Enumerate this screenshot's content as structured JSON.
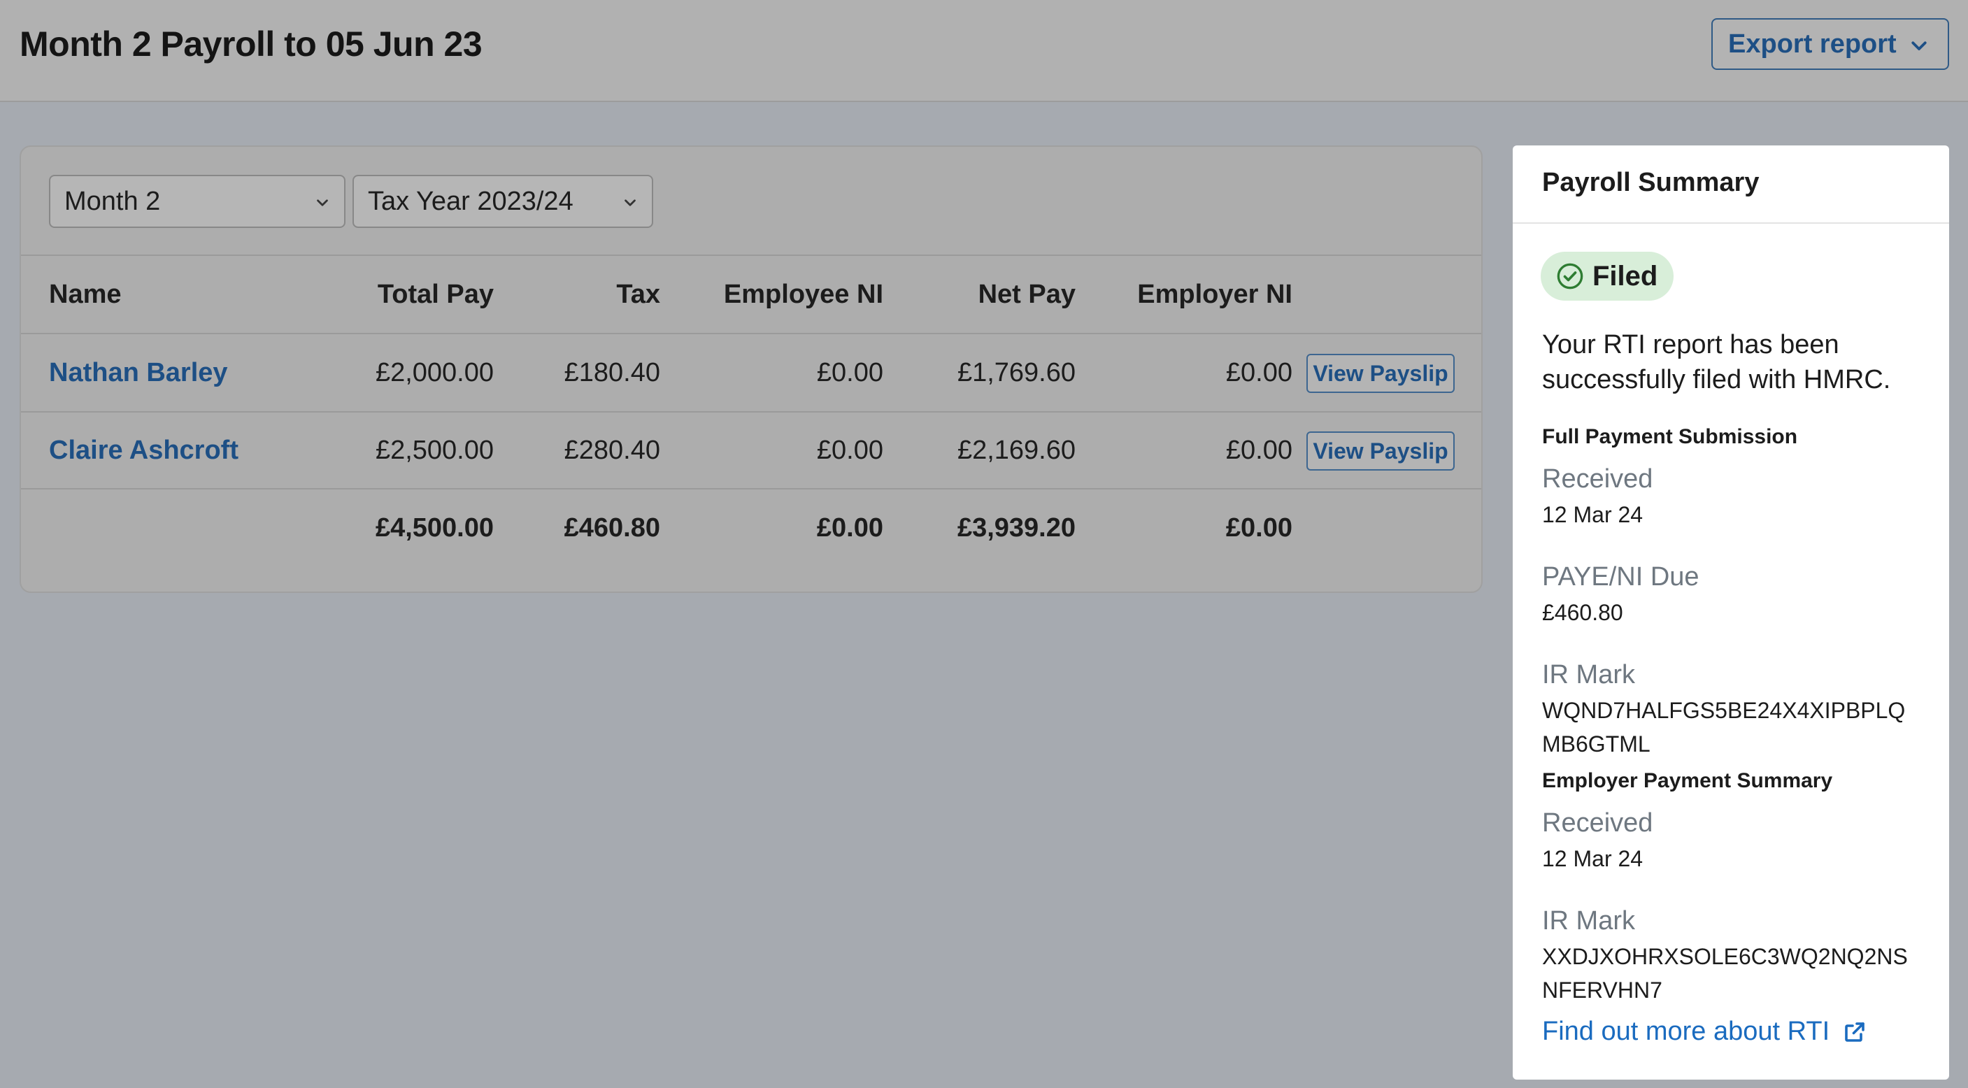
{
  "header": {
    "title": "Month 2 Payroll to 05 Jun 23",
    "export_label": "Export report"
  },
  "filters": {
    "month": "Month 2",
    "tax_year": "Tax Year 2023/24"
  },
  "table": {
    "columns": [
      "Name",
      "Total Pay",
      "Tax",
      "Employee NI",
      "Net Pay",
      "Employer NI"
    ],
    "rows": [
      {
        "name": "Nathan Barley",
        "total_pay": "£2,000.00",
        "tax": "£180.40",
        "employee_ni": "£0.00",
        "net_pay": "£1,769.60",
        "employer_ni": "£0.00",
        "action": "View Payslip"
      },
      {
        "name": "Claire Ashcroft",
        "total_pay": "£2,500.00",
        "tax": "£280.40",
        "employee_ni": "£0.00",
        "net_pay": "£2,169.60",
        "employer_ni": "£0.00",
        "action": "View Payslip"
      }
    ],
    "totals": {
      "total_pay": "£4,500.00",
      "tax": "£460.80",
      "employee_ni": "£0.00",
      "net_pay": "£3,939.20",
      "employer_ni": "£0.00"
    }
  },
  "summary": {
    "title": "Payroll Summary",
    "status": "Filed",
    "status_color": "#2e7d32",
    "message_line1": "Your RTI report has been",
    "message_line2": "successfully filed with HMRC.",
    "fps": {
      "heading": "Full Payment Submission",
      "received_label": "Received",
      "received_value": "12 Mar 24",
      "due_label": "PAYE/NI Due",
      "due_value": "£460.80",
      "irmark_label": "IR Mark",
      "irmark_line1": "WQND7HALFGS5BE24X4XIPBPLQ",
      "irmark_line2": "MB6GTML"
    },
    "eps": {
      "heading": "Employer Payment Summary",
      "received_label": "Received",
      "received_value": "12 Mar 24",
      "irmark_label": "IR Mark",
      "irmark_line1": "XXDJXOHRXSOLE6C3WQ2NQ2NS",
      "irmark_line2": "NFERVHN7"
    },
    "link_label": "Find out more about RTI",
    "link_icon": "external-link-icon"
  }
}
